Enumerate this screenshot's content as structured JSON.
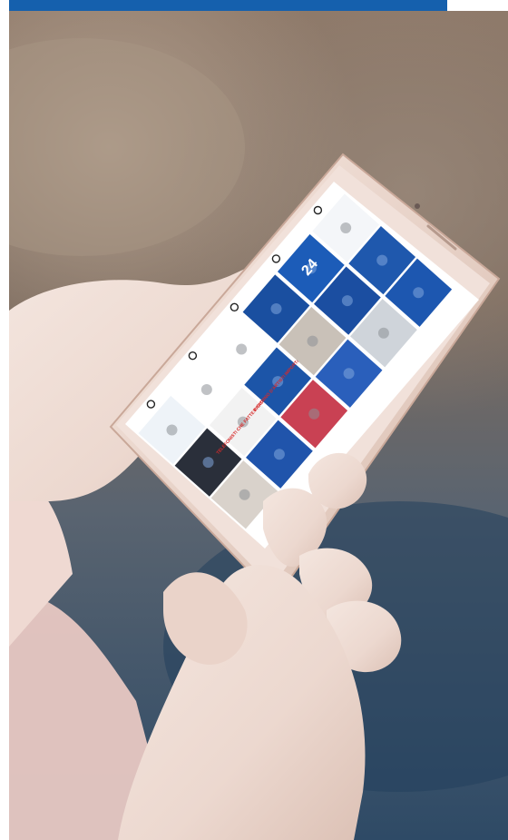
{
  "scene": {
    "description_free": true,
    "accent_color": "#1560ad",
    "phone_color": "#e9d6cc"
  },
  "phone_screen": {
    "app": "instagram-profile-grid",
    "tiles": [
      {
        "id": "t1",
        "text": "",
        "bg": "#eef3f8"
      },
      {
        "id": "t2",
        "text": "",
        "bg": "#ffffff"
      },
      {
        "id": "t3",
        "text": "",
        "bg": "#ffffff"
      },
      {
        "id": "t4",
        "text": "",
        "bg": "#1a4fa0"
      },
      {
        "id": "t5",
        "text": "24",
        "bg": "#1c5cb8"
      },
      {
        "id": "t6",
        "text": "",
        "bg": "#f4f6f9"
      },
      {
        "id": "t7",
        "text": "",
        "bg": "#2a2f3a"
      },
      {
        "id": "t8",
        "text": "TELEFONISTI CHE FATTE PRATEITTE",
        "bg": "#f2f2f2"
      },
      {
        "id": "t9",
        "text": "IL GIORNO D'ARTISTI IMPORTANTI",
        "bg": "#1c55a8"
      },
      {
        "id": "t10",
        "text": "",
        "bg": "#c9c1b8"
      },
      {
        "id": "t11",
        "text": "",
        "bg": "#1b4ea1"
      },
      {
        "id": "t12",
        "text": "",
        "bg": "#1f58ad"
      },
      {
        "id": "t13",
        "text": "",
        "bg": "#d9d2cb"
      },
      {
        "id": "t14",
        "text": "",
        "bg": "#2054ab"
      },
      {
        "id": "t15",
        "text": "",
        "bg": "#c94153"
      },
      {
        "id": "t16",
        "text": "",
        "bg": "#2a5fbb"
      },
      {
        "id": "t17",
        "text": "",
        "bg": "#cfd4da"
      },
      {
        "id": "t18",
        "text": "",
        "bg": "#1d57b0"
      }
    ],
    "nav": [
      "home-icon",
      "search-icon",
      "add-icon",
      "reels-icon",
      "profile-icon"
    ]
  }
}
